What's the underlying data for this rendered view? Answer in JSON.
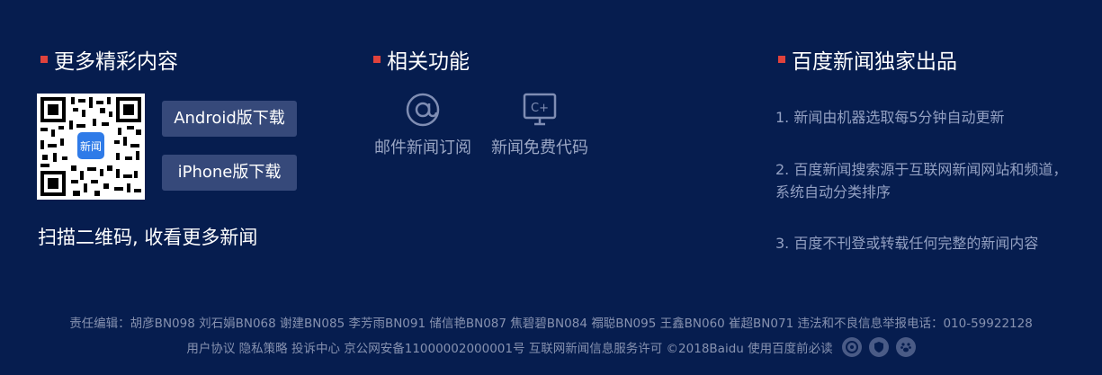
{
  "left": {
    "title": "更多精彩内容",
    "qr_app_label": "新闻",
    "android_button": "Android版下载",
    "iphone_button": "iPhone版下载",
    "scan_caption": "扫描二维码, 收看更多新闻"
  },
  "middle": {
    "title": "相关功能",
    "functions": [
      {
        "label": "邮件新闻订阅",
        "icon": "at-icon"
      },
      {
        "label": "新闻免费代码",
        "icon": "code-monitor-icon"
      }
    ],
    "code_glyph": "C+"
  },
  "right": {
    "title": "百度新闻独家出品",
    "notes": [
      "1. 新闻由机器选取每5分钟自动更新",
      "2. 百度新闻搜索源于互联网新闻网站和频道，系统自动分类排序",
      "3. 百度不刊登或转载任何完整的新闻内容"
    ]
  },
  "footer": {
    "editors": "责任编辑：胡彦BN098 刘石娟BN068 谢建BN085 李芳雨BN091 储信艳BN087 焦碧碧BN084 禤聪BN095 王鑫BN060 崔超BN071 违法和不良信息举报电话：010-59922128",
    "links": "用户协议 隐私策略 投诉中心 京公网安备11000002000001号 互联网新闻信息服务许可 ©2018Baidu 使用百度前必读",
    "badges": [
      "police-badge-icon",
      "shield-badge-icon",
      "baidu-paw-icon"
    ]
  },
  "colors": {
    "background": "#061d4f",
    "accent_square": "#e0423c",
    "button": "#36497a",
    "muted_text": "#93a0c2"
  }
}
